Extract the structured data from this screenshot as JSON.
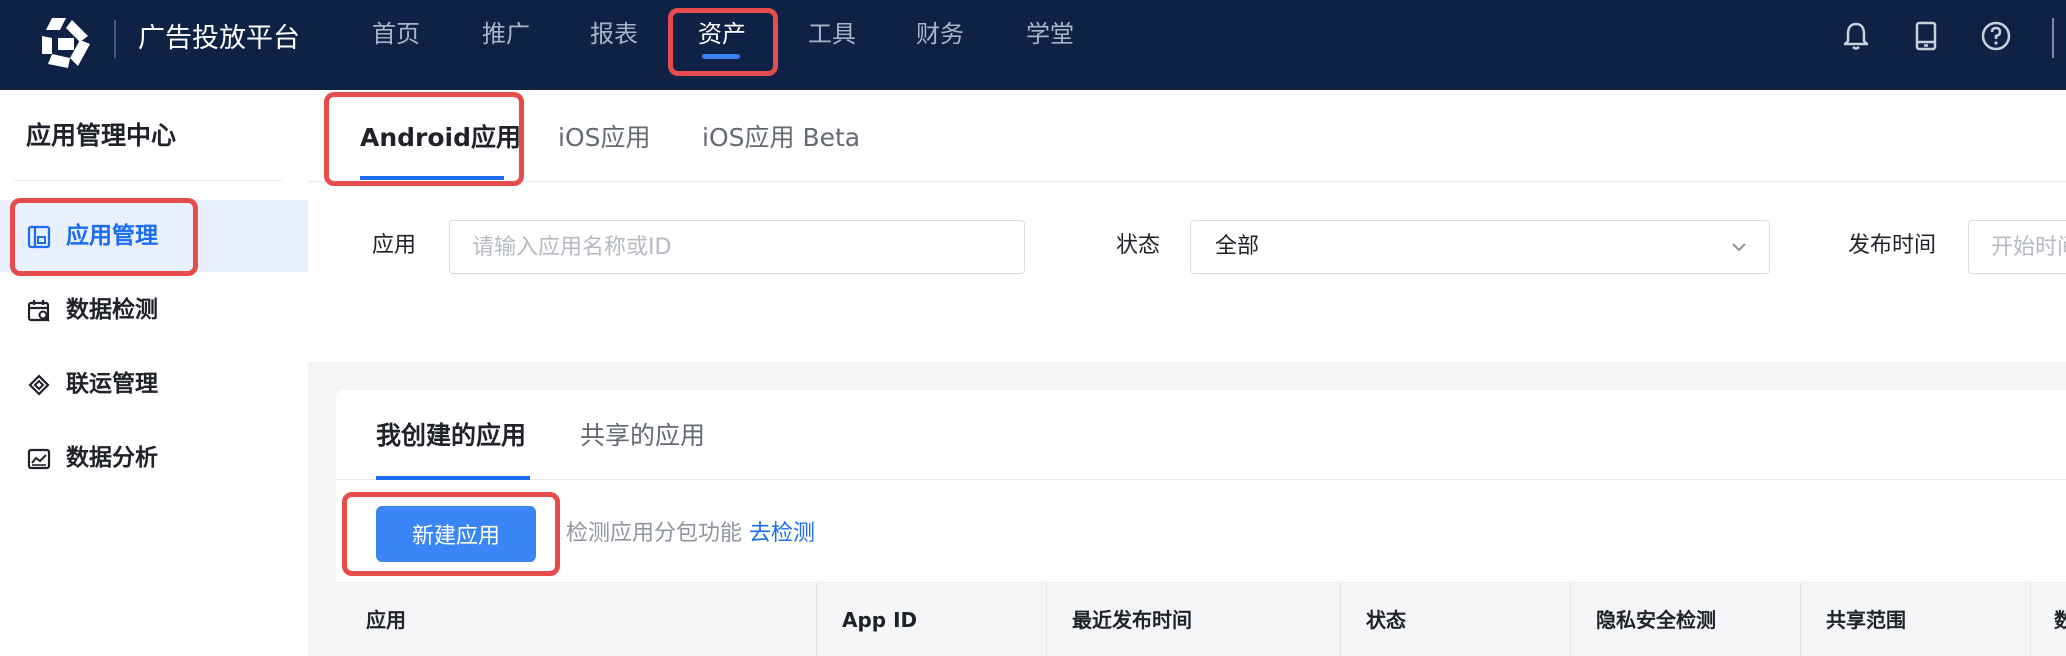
{
  "header": {
    "brand": "广告投放平台",
    "nav": [
      "首页",
      "推广",
      "报表",
      "资产",
      "工具",
      "财务",
      "学堂"
    ],
    "active_nav": "资产",
    "icons": [
      "bell-icon",
      "tablet-icon",
      "help-icon"
    ]
  },
  "sidebar": {
    "title": "应用管理中心",
    "items": [
      {
        "label": "应用管理",
        "icon": "app-manage-icon",
        "active": true
      },
      {
        "label": "数据检测",
        "icon": "calendar-search-icon"
      },
      {
        "label": "联运管理",
        "icon": "joint-ops-icon"
      },
      {
        "label": "数据分析",
        "icon": "chart-icon"
      }
    ]
  },
  "main": {
    "tabs": [
      "Android应用",
      "iOS应用",
      "iOS应用 Beta"
    ],
    "active_tab": "Android应用",
    "filters": {
      "app_label": "应用",
      "app_placeholder": "请输入应用名称或ID",
      "status_label": "状态",
      "status_value": "全部",
      "date_label": "发布时间",
      "date_placeholder": "开始时间"
    },
    "card": {
      "subtabs": [
        "我创建的应用",
        "共享的应用"
      ],
      "active_subtab": "我创建的应用",
      "new_button": "新建应用",
      "hint_text": "检测应用分包功能",
      "hint_link": "去检测",
      "columns": [
        "应用",
        "App ID",
        "最近发布时间",
        "状态",
        "隐私安全检测",
        "共享范围",
        "数"
      ]
    }
  },
  "colors": {
    "header_bg": "#0f2145",
    "accent": "#1a6cf0",
    "primary_button": "#3a86f6",
    "highlight": "#e74c4c"
  }
}
